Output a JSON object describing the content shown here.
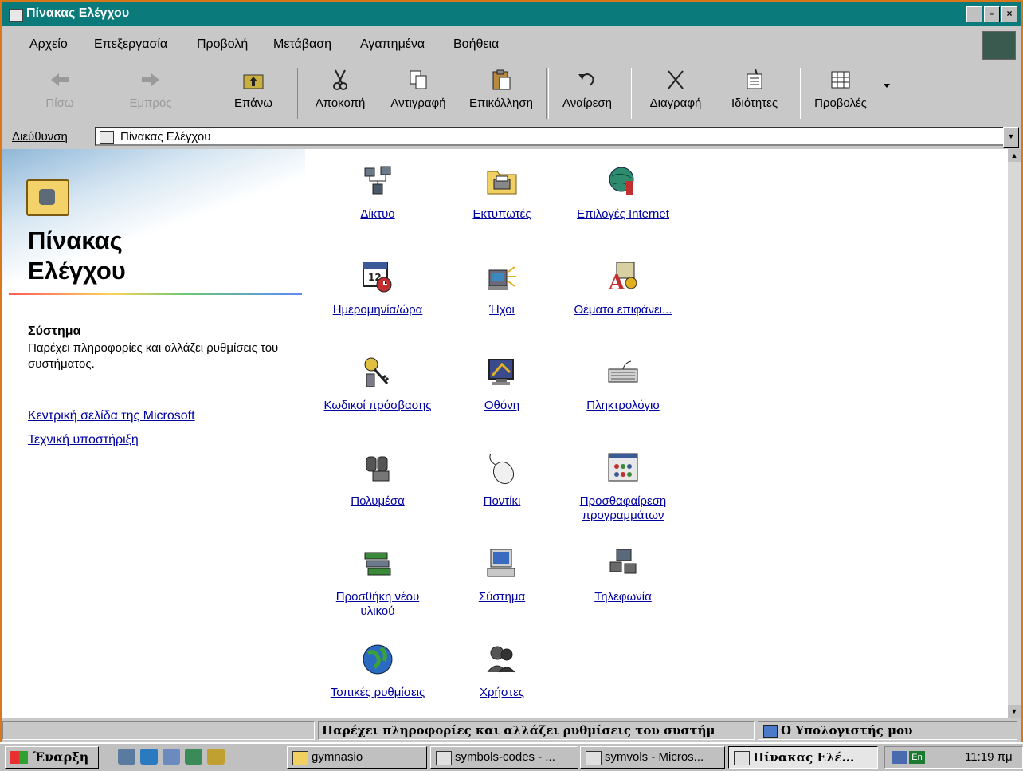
{
  "window": {
    "title": "Πίνακας Ελέγχου",
    "buttons": [
      "_",
      "▫",
      "×"
    ]
  },
  "menu": [
    "Αρχείο",
    "Επεξεργασία",
    "Προβολή",
    "Μετάβαση",
    "Αγαπημένα",
    "Βοήθεια"
  ],
  "toolbar": {
    "back": "Πίσω",
    "forward": "Εμπρός",
    "up": "Επάνω",
    "cut": "Αποκοπή",
    "copy": "Αντιγραφή",
    "paste": "Επικόλληση",
    "undo": "Αναίρεση",
    "delete": "Διαγραφή",
    "properties": "Ιδιότητες",
    "views": "Προβολές"
  },
  "address": {
    "label": "Διεύθυνση",
    "value": "Πίνακας Ελέγχου"
  },
  "left_pane": {
    "title_line1": "Πίνακας",
    "title_line2": "Ελέγχου",
    "selected_name": "Σύστημα",
    "selected_desc": "Παρέχει πληροφορίες και αλλάζει ρυθμίσεις του συστήματος.",
    "link_microsoft": "Κεντρική σελίδα της Microsoft",
    "link_support": "Τεχνική υποστήριξη"
  },
  "items": [
    {
      "label": "Δίκτυο",
      "icon": "network-icon"
    },
    {
      "label": "Εκτυπωτές",
      "icon": "printers-folder-icon"
    },
    {
      "label": "Επιλογές Internet",
      "icon": "internet-globe-icon"
    },
    {
      "label": "Ημερομηνία/ώρα",
      "icon": "calendar-clock-icon"
    },
    {
      "label": "Ήχοι",
      "icon": "speaker-icon"
    },
    {
      "label": "Θέματα επιφάνει...",
      "icon": "desktop-themes-icon"
    },
    {
      "label": "Κωδικοί πρόσβασης",
      "icon": "keys-icon"
    },
    {
      "label": "Οθόνη",
      "icon": "monitor-icon"
    },
    {
      "label": "Πληκτρολόγιο",
      "icon": "keyboard-icon"
    },
    {
      "label": "Πολυμέσα",
      "icon": "multimedia-icon"
    },
    {
      "label": "Ποντίκι",
      "icon": "mouse-icon"
    },
    {
      "label": "Προσθαφαίρεση προγραμμάτων",
      "icon": "add-remove-programs-icon"
    },
    {
      "label": "Προσθήκη νέου υλικού",
      "icon": "add-hardware-icon"
    },
    {
      "label": "Σύστημα",
      "icon": "computer-icon"
    },
    {
      "label": "Τηλεφωνία",
      "icon": "telephony-icon"
    },
    {
      "label": "Τοπικές ρυθμίσεις",
      "icon": "regional-globe-icon"
    },
    {
      "label": "Χρήστες",
      "icon": "users-icon"
    }
  ],
  "statusbar": {
    "text": "Παρέχει πληροφορίες και αλλάζει ρυθμίσεις του συστήμ",
    "zone": "Ο Υπολογιστής μου"
  },
  "taskbar": {
    "start": "Έναρξη",
    "buttons": [
      "gymnasio",
      "symbols-codes - ...",
      "symvols - Micros...",
      "Πίνακας Ελέ..."
    ],
    "tray_lang": "En",
    "clock": "11:19 πμ"
  }
}
